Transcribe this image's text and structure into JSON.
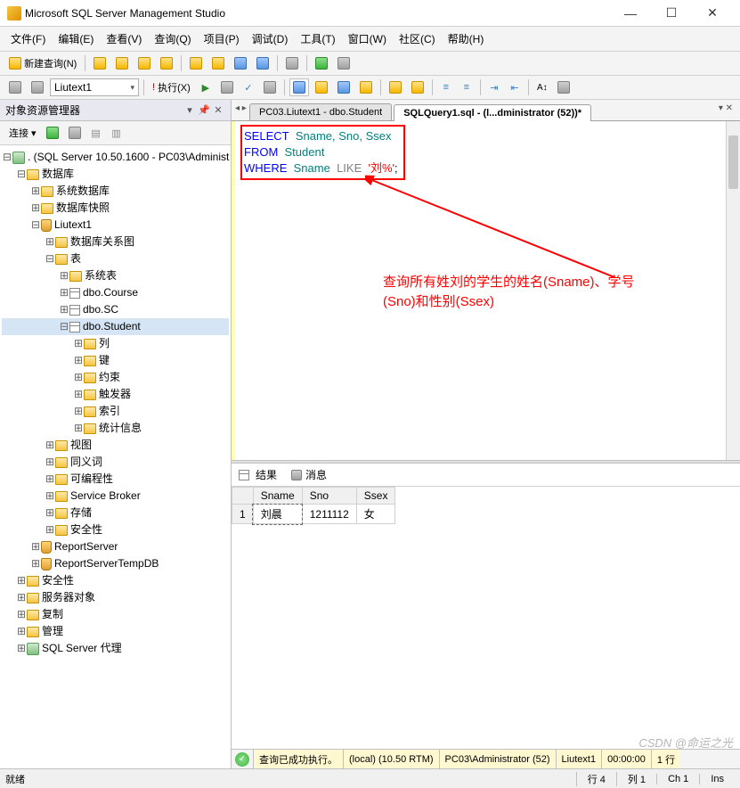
{
  "title": "Microsoft SQL Server Management Studio",
  "menu": [
    "文件(F)",
    "编辑(E)",
    "查看(V)",
    "查询(Q)",
    "项目(P)",
    "调试(D)",
    "工具(T)",
    "窗口(W)",
    "社区(C)",
    "帮助(H)"
  ],
  "toolbar": {
    "newquery": "新建查询(N)"
  },
  "toolbar2": {
    "combo1": "Liutext1",
    "execute": "执行(X)"
  },
  "sidebar": {
    "title": "对象资源管理器",
    "connect": "连接 ▾",
    "server": ". (SQL Server 10.50.1600 - PC03\\Administ",
    "nodes": {
      "databases": "数据库",
      "sysdb": "系统数据库",
      "snapshot": "数据库快照",
      "liutext": "Liutext1",
      "diagram": "数据库关系图",
      "tables": "表",
      "systables": "系统表",
      "course": "dbo.Course",
      "sc": "dbo.SC",
      "student": "dbo.Student",
      "cols": "列",
      "keys": "键",
      "constraints": "约束",
      "triggers": "触发器",
      "indexes": "索引",
      "stats": "统计信息",
      "views": "视图",
      "synonyms": "同义词",
      "programmability": "可编程性",
      "servicebroker": "Service Broker",
      "storage": "存储",
      "security_db": "安全性",
      "reportserver": "ReportServer",
      "reportservertemp": "ReportServerTempDB",
      "security": "安全性",
      "serverobjects": "服务器对象",
      "replication": "复制",
      "management": "管理",
      "agent": "SQL Server 代理"
    }
  },
  "tabs": {
    "t1": "PC03.Liutext1 - dbo.Student",
    "t2": "SQLQuery1.sql - (l...dministrator (52))*"
  },
  "sql": {
    "l1a": "SELECT",
    "l1b": "Sname, Sno, Ssex",
    "l2a": "FROM",
    "l2b": "Student",
    "l3a": "WHERE",
    "l3b": "Sname",
    "l3c": "LIKE",
    "l3d": "'刘%'",
    "l3e": ";"
  },
  "annotation": {
    "line1": "查询所有姓刘的学生的姓名(Sname)、学号",
    "line2": "(Sno)和性别(Ssex)"
  },
  "results": {
    "tab1": "结果",
    "tab2": "消息",
    "cols": [
      "Sname",
      "Sno",
      "Ssex"
    ],
    "rows": [
      {
        "n": "1",
        "sname": "刘晨",
        "sno": "1211112",
        "ssex": "女"
      }
    ]
  },
  "status": {
    "ok": "查询已成功执行。",
    "server": "(local) (10.50 RTM)",
    "user": "PC03\\Administrator (52)",
    "db": "Liutext1",
    "time": "00:00:00",
    "rows": "1 行"
  },
  "bottom": {
    "ready": "就绪",
    "row": "行 4",
    "col": "列 1",
    "ch": "Ch 1",
    "ins": "Ins"
  },
  "watermark": "CSDN @命运之光"
}
